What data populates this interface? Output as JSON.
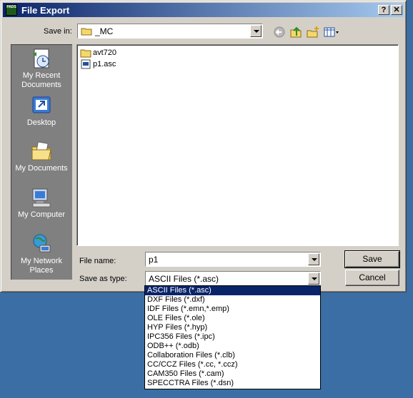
{
  "window": {
    "title": "File Export",
    "app_icon_text": "PADS",
    "help_label": "?",
    "close_label": "✕"
  },
  "save_in": {
    "label": "Save in:",
    "value": "_MC"
  },
  "toolbar": {
    "icons": [
      "back-icon",
      "up-folder-icon",
      "new-folder-icon",
      "view-menu-icon"
    ]
  },
  "places": [
    {
      "label": "My Recent Documents",
      "icon": "recent-documents-icon"
    },
    {
      "label": "Desktop",
      "icon": "desktop-icon"
    },
    {
      "label": "My Documents",
      "icon": "my-documents-icon"
    },
    {
      "label": "My Computer",
      "icon": "my-computer-icon"
    },
    {
      "label": "My Network Places",
      "icon": "network-places-icon"
    }
  ],
  "files": [
    {
      "name": "avt720",
      "icon": "folder-icon"
    },
    {
      "name": "p1.asc",
      "icon": "asc-file-icon"
    }
  ],
  "file_name": {
    "label": "File name:",
    "value": "p1"
  },
  "save_as_type": {
    "label": "Save as type:",
    "value": "ASCII Files (*.asc)",
    "options": [
      "ASCII Files (*.asc)",
      "DXF Files (*.dxf)",
      "IDF Files (*.emn,*.emp)",
      "OLE Files (*.ole)",
      "HYP Files (*.hyp)",
      "IPC356 Files (*.ipc)",
      "ODB++ (*.odb)",
      "Collaboration Files (*.clb)",
      "CC/CCZ Files (*.cc, *.ccz)",
      "CAM350 Files (*.cam)",
      "SPECCTRA Files (*.dsn)"
    ],
    "selected_index": 0
  },
  "buttons": {
    "save": "Save",
    "cancel": "Cancel"
  },
  "colors": {
    "desktop": "#3a6ea5",
    "titlebar_start": "#0a246a",
    "titlebar_end": "#a6caf0",
    "face": "#d4d0c8",
    "places_bar": "#808080",
    "selection": "#0a246a"
  }
}
